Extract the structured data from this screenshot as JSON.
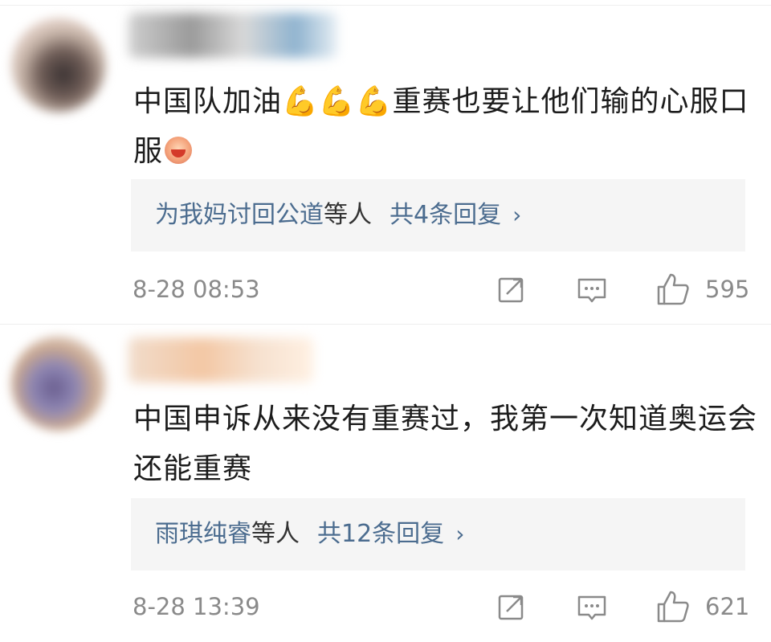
{
  "comments": [
    {
      "text_main": "中国队加油",
      "arm_emoji": "💪💪💪",
      "text_rest": "重赛也要让他们输的心服口服",
      "reply": {
        "names": "为我妈讨回公道",
        "suffix": "等人",
        "count": "共4条回复",
        "chevron": "›"
      },
      "time": "8-28 08:53",
      "likes": "595"
    },
    {
      "text": "中国申诉从来没有重赛过，我第一次知道奥运会还能重赛",
      "reply": {
        "names": "雨琪纯睿",
        "suffix": "等人",
        "count": "共12条回复",
        "chevron": "›"
      },
      "time": "8-28 13:39",
      "likes": "621"
    }
  ],
  "icons": [
    "share-icon",
    "comment-icon",
    "like-icon",
    "laughing-emoji-icon"
  ],
  "colors": {
    "link": "#4b6c8f",
    "meta": "#8a8a8a",
    "reply_bg": "#f5f5f5"
  }
}
